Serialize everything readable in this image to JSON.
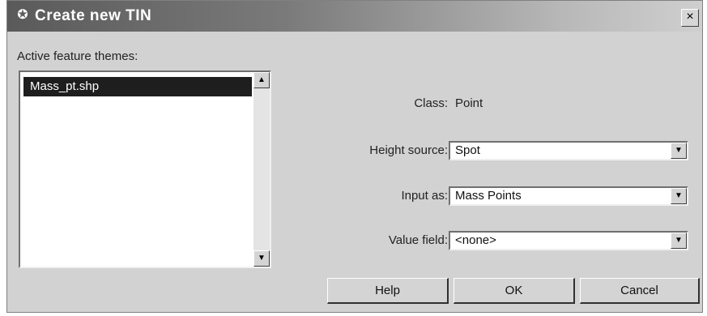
{
  "window": {
    "title": "Create new TIN",
    "close_glyph": "×"
  },
  "themes": {
    "label": "Active feature themes:",
    "items": [
      "Mass_pt.shp"
    ],
    "scroll_up": "▲",
    "scroll_down": "▼"
  },
  "form": {
    "class_label": "Class:",
    "class_value": "Point",
    "height_label": "Height source:",
    "height_value": "Spot",
    "input_label": "Input as:",
    "input_value": "Mass Points",
    "value_label": "Value field:",
    "value_value": "<none>",
    "dropdown_glyph": "▼"
  },
  "buttons": {
    "help": "Help",
    "ok": "OK",
    "cancel": "Cancel"
  },
  "icons": {
    "title": "tin-icon",
    "close": "close-icon"
  }
}
